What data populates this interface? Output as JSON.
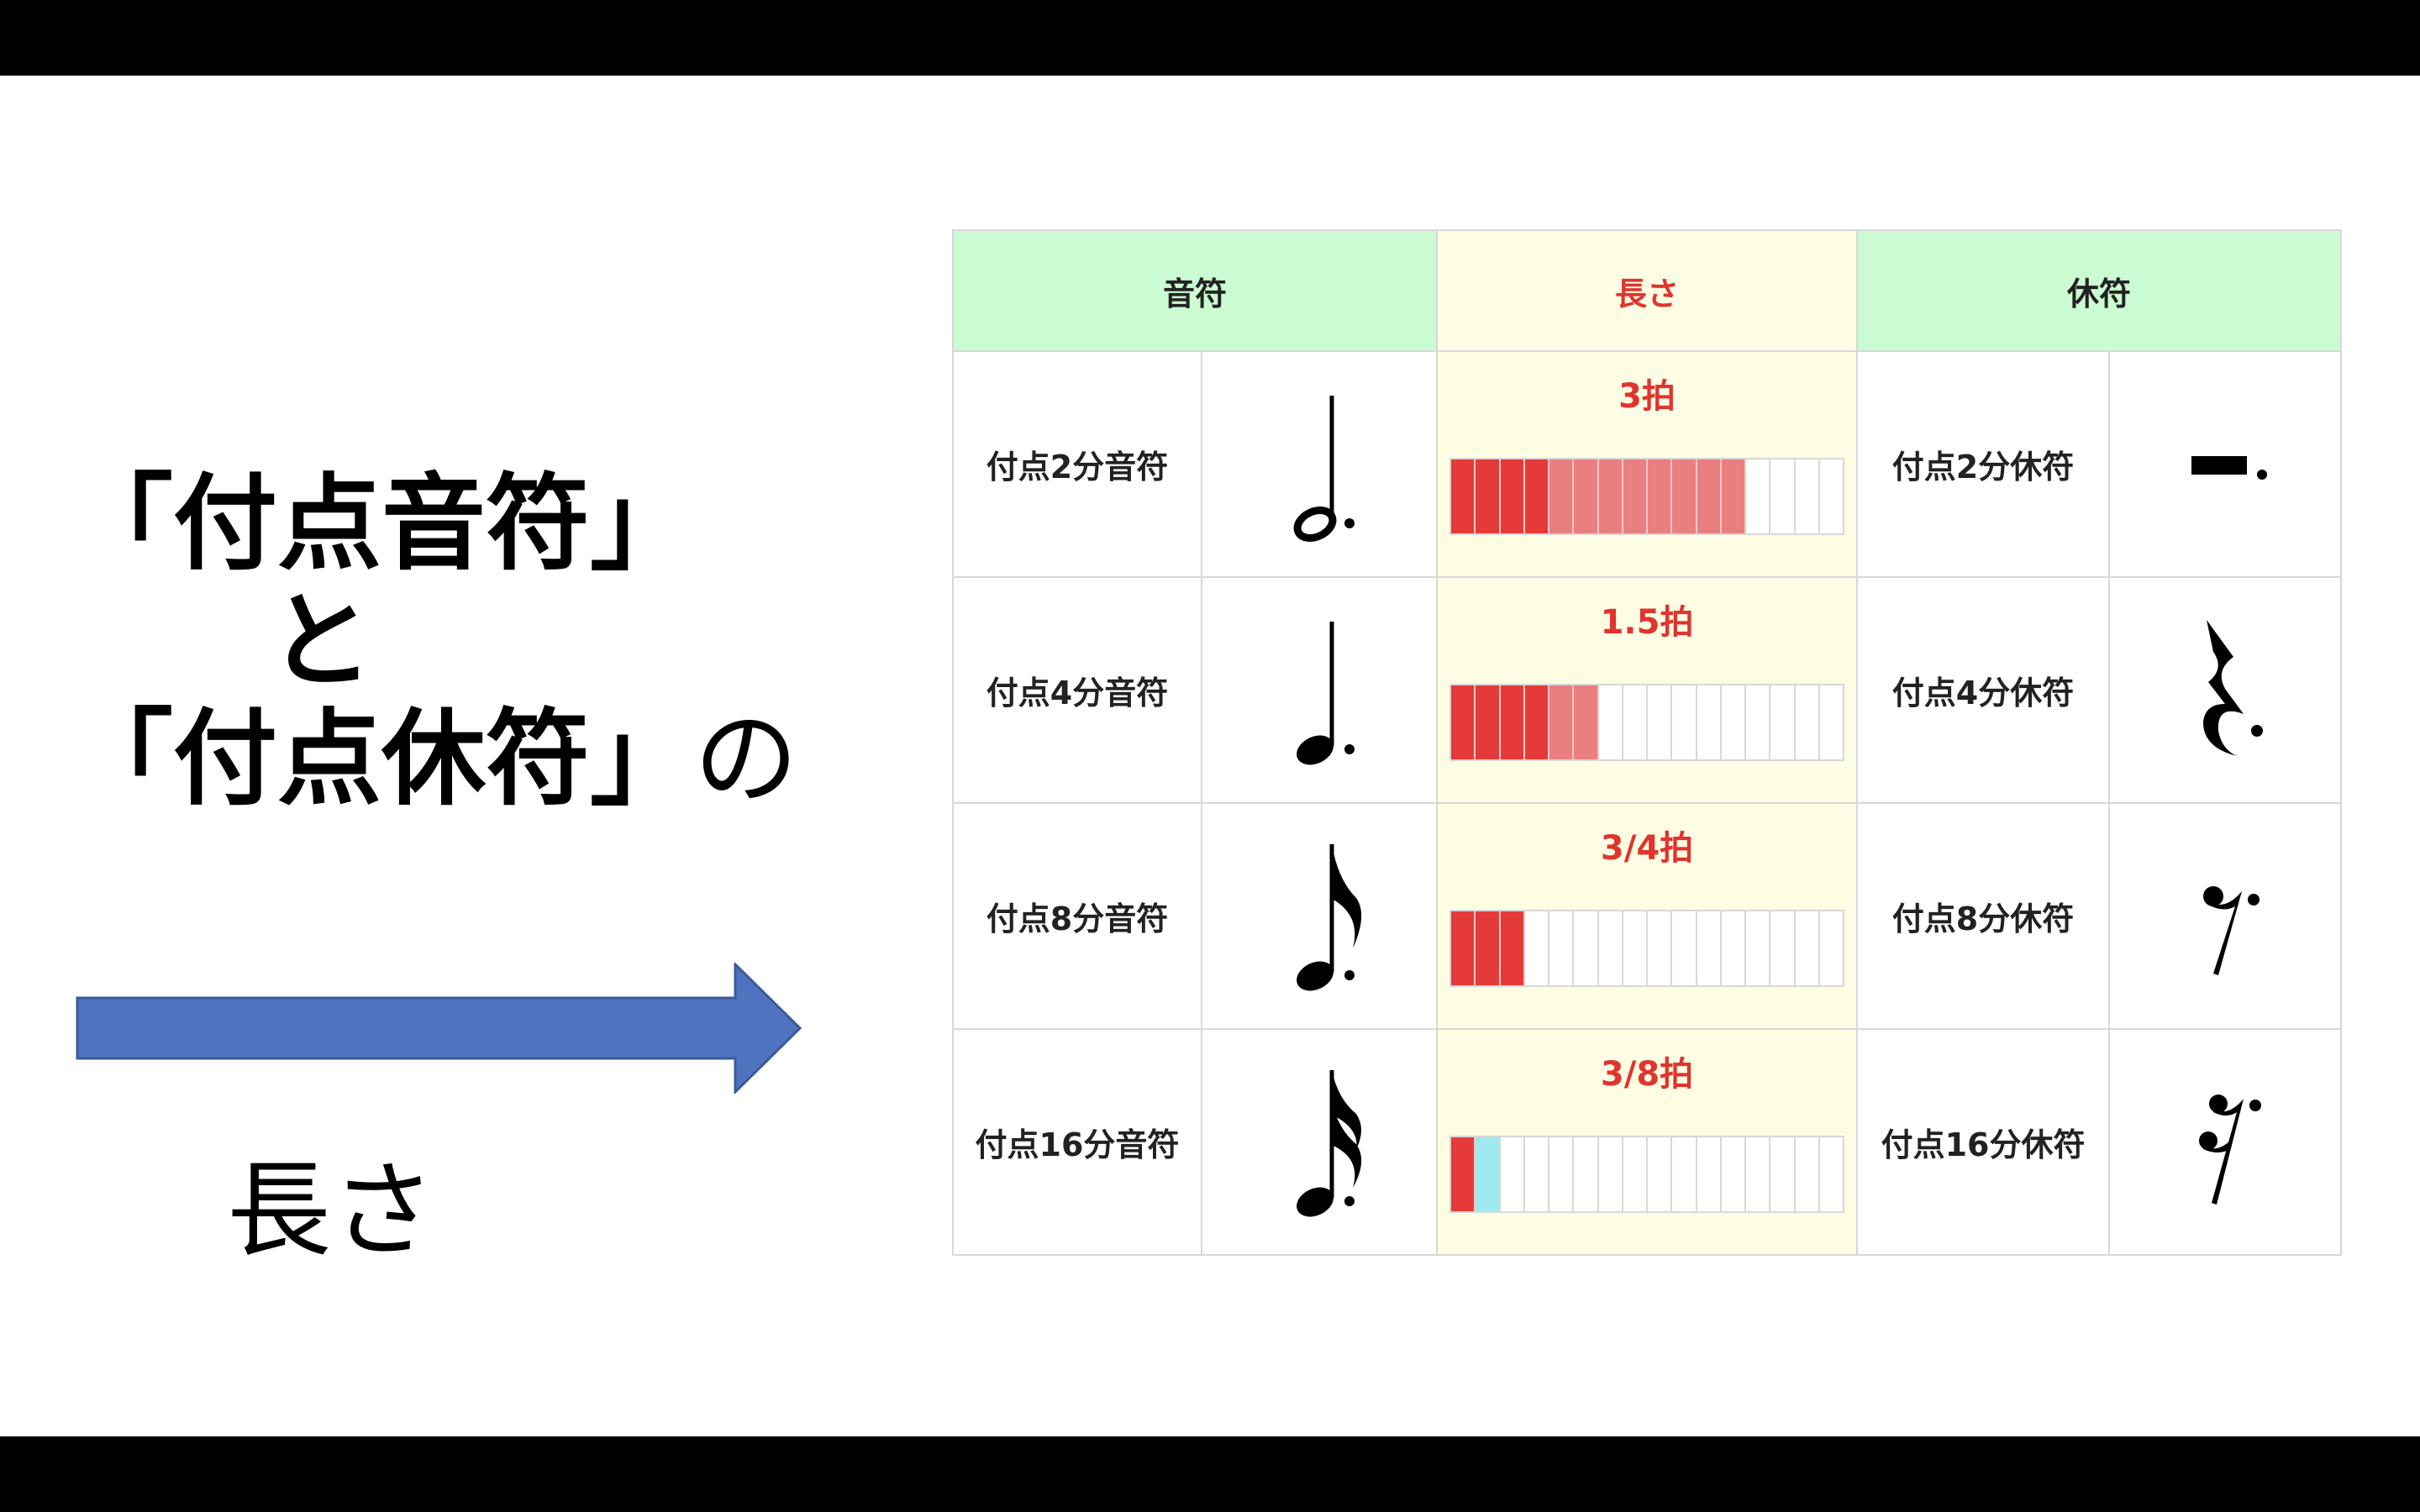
{
  "title": {
    "line1": "「付点音符」",
    "line2": "と",
    "line3_main": "「付点休符」",
    "line3_suffix": "の",
    "length_label": "長さ"
  },
  "colors": {
    "header_green": "#cbfbd2",
    "header_yellow": "#fdfde3",
    "bar_red": "#e53a3a",
    "bar_pink": "#e97f7f",
    "bar_cyan": "#9fe8ee",
    "arrow_blue": "#4f73be",
    "accent_red": "#e0342f"
  },
  "table": {
    "headers": {
      "note": "音符",
      "length": "長さ",
      "rest": "休符"
    },
    "rows": [
      {
        "note_name": "付点2分音符",
        "note_icon": "dotted-half-note-icon",
        "beats": "3拍",
        "rest_name": "付点2分休符",
        "rest_icon": "dotted-half-rest-icon",
        "bar": {
          "red": 4,
          "pink": 8,
          "cyan": 0,
          "total": 16
        }
      },
      {
        "note_name": "付点4分音符",
        "note_icon": "dotted-quarter-note-icon",
        "beats": "1.5拍",
        "rest_name": "付点4分休符",
        "rest_icon": "dotted-quarter-rest-icon",
        "bar": {
          "red": 4,
          "pink": 2,
          "cyan": 0,
          "total": 16
        }
      },
      {
        "note_name": "付点8分音符",
        "note_icon": "dotted-eighth-note-icon",
        "beats": "3/4拍",
        "rest_name": "付点8分休符",
        "rest_icon": "dotted-eighth-rest-icon",
        "bar": {
          "red": 3,
          "pink": 0,
          "cyan": 0,
          "total": 16
        }
      },
      {
        "note_name": "付点16分音符",
        "note_icon": "dotted-sixteenth-note-icon",
        "beats": "3/8拍",
        "rest_name": "付点16分休符",
        "rest_icon": "dotted-sixteenth-rest-icon",
        "bar": {
          "red": 1,
          "pink": 0,
          "cyan": 1,
          "total": 16
        }
      }
    ]
  }
}
